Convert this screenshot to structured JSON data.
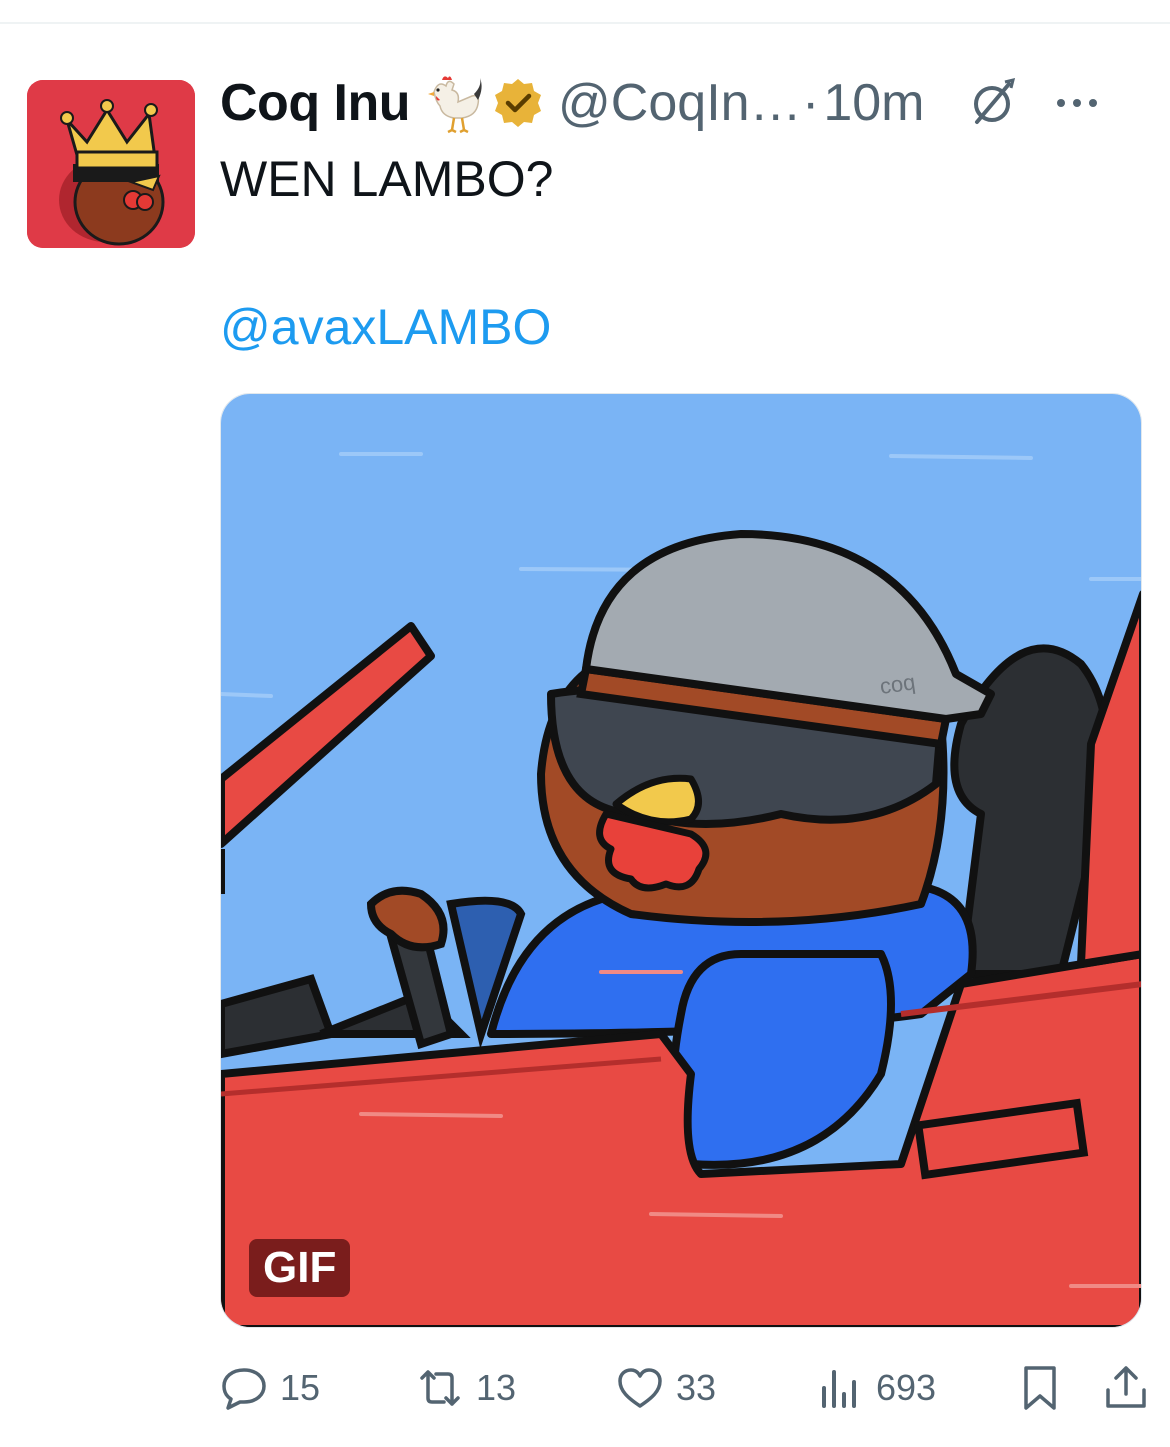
{
  "tweet": {
    "author_name": "Coq Inu",
    "author_emoji": "rooster-emoji",
    "verified": "gold-verified-badge",
    "handle": "@CoqIn…",
    "separator": "·",
    "timestamp": "10m",
    "text": "WEN LAMBO?",
    "mention": "@avaxLAMBO",
    "media": {
      "type": "gif",
      "badge": "GIF",
      "description_icons": "rooster-driving-red-car"
    }
  },
  "actions": {
    "replies": "15",
    "reposts": "13",
    "likes": "33",
    "views": "693"
  },
  "colors": {
    "accent": "#1d9bf0",
    "secondary_text": "#536471",
    "avatar_bg": "#df3a47"
  }
}
